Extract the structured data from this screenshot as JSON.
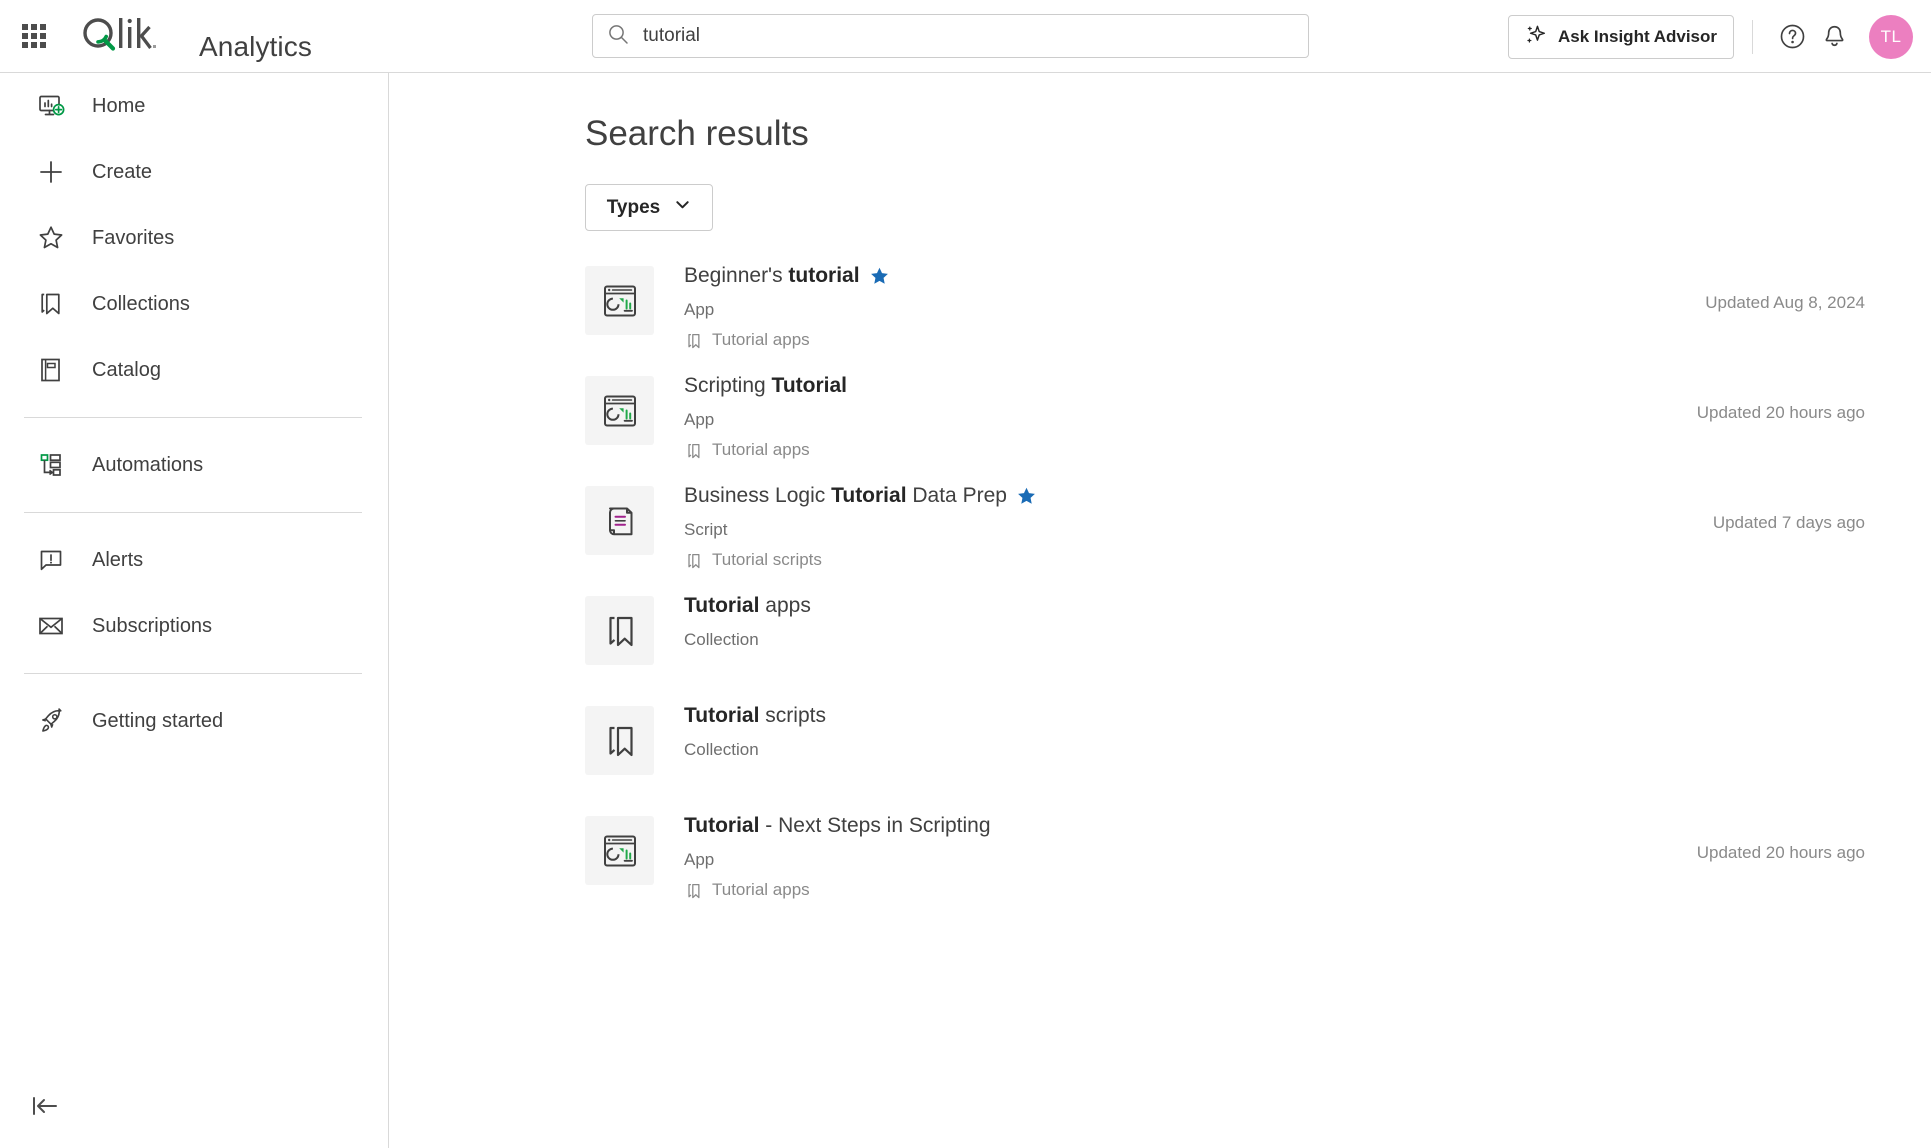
{
  "topbar": {
    "launcher_icon": "grid-apps-icon",
    "logo_text": "Qlik",
    "app_title": "Analytics",
    "search": {
      "value": "tutorial",
      "placeholder": "Search",
      "icon": "search-icon"
    },
    "insight_button": {
      "label": "Ask Insight Advisor",
      "icon": "sparkle-icon"
    },
    "help_icon": "help-circle-icon",
    "notifications_icon": "bell-icon",
    "avatar_initials": "TL",
    "avatar_color": "#ec7fc0"
  },
  "sidebar": {
    "items": [
      {
        "label": "Home",
        "icon": "home-monitor-plus-icon",
        "sep_after": false
      },
      {
        "label": "Create",
        "icon": "plus-icon",
        "sep_after": false
      },
      {
        "label": "Favorites",
        "icon": "star-outline-icon",
        "sep_after": false
      },
      {
        "label": "Collections",
        "icon": "bookmark-icon",
        "sep_after": false
      },
      {
        "label": "Catalog",
        "icon": "book-icon",
        "sep_after": true
      },
      {
        "label": "Automations",
        "icon": "automation-flow-icon",
        "sep_after": true
      },
      {
        "label": "Alerts",
        "icon": "alert-bubble-icon",
        "sep_after": false
      },
      {
        "label": "Subscriptions",
        "icon": "envelope-icon",
        "sep_after": true
      },
      {
        "label": "Getting started",
        "icon": "rocket-icon",
        "sep_after": false
      }
    ],
    "collapse_icon": "collapse-left-icon"
  },
  "main": {
    "title": "Search results",
    "types_filter": {
      "label": "Types",
      "icon": "chevron-down-icon"
    },
    "results": [
      {
        "title_pre": "Beginner's ",
        "title_match": "tutorial",
        "title_post": "",
        "favorite": true,
        "type": "App",
        "collection": "Tutorial apps",
        "updated": "Updated Aug 8, 2024",
        "icon": "app-chart-icon"
      },
      {
        "title_pre": "Scripting ",
        "title_match": "Tutorial",
        "title_post": "",
        "favorite": false,
        "type": "App",
        "collection": "Tutorial apps",
        "updated": "Updated 20 hours ago",
        "icon": "app-chart-icon"
      },
      {
        "title_pre": "Business Logic ",
        "title_match": "Tutorial",
        "title_post": " Data Prep",
        "favorite": true,
        "type": "Script",
        "collection": "Tutorial scripts",
        "updated": "Updated 7 days ago",
        "icon": "script-scroll-icon"
      },
      {
        "title_pre": "",
        "title_match": "Tutorial",
        "title_post": " apps",
        "favorite": false,
        "type": "Collection",
        "collection": "",
        "updated": "",
        "icon": "collection-bookmark-icon"
      },
      {
        "title_pre": "",
        "title_match": "Tutorial",
        "title_post": " scripts",
        "favorite": false,
        "type": "Collection",
        "collection": "",
        "updated": "",
        "icon": "collection-bookmark-icon"
      },
      {
        "title_pre": "",
        "title_match": "Tutorial",
        "title_post": " - Next Steps in Scripting",
        "favorite": false,
        "type": "App",
        "collection": "Tutorial apps",
        "updated": "Updated 20 hours ago",
        "icon": "app-chart-icon"
      }
    ]
  },
  "colors": {
    "qlik_green": "#009845",
    "favorite_star": "#1a6bb5",
    "script_accent": "#a0228c",
    "text_primary": "#404040",
    "text_muted": "#8a8a8a"
  }
}
